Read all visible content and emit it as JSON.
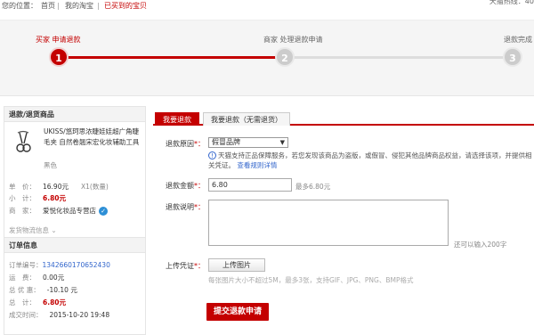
{
  "breadcrumb": {
    "label": "您的位置：",
    "items": [
      "首页",
      "我的淘宝",
      "已买到的宝贝"
    ],
    "sep": "|",
    "hotline": "天猫热线：40"
  },
  "steps": [
    {
      "num": "1",
      "label": "买家 申请退款",
      "active": true
    },
    {
      "num": "2",
      "label": "商家 处理退款申请",
      "active": false
    },
    {
      "num": "3",
      "label": "退款完成",
      "active": false
    }
  ],
  "product": {
    "section_title": "退款/退货商品",
    "name": "UKISS/悠珂思浓睫娃娃超广角睫毛夹 自然卷翘宋宏化妆辅助工具",
    "attr": "黑色",
    "unit_label": "单　价：",
    "unit_price": "16.90元",
    "quantity": "X1(数量)",
    "subtotal_label": "小　计：",
    "subtotal": "6.80元",
    "shop_label": "商　家：",
    "shop": "爱悦化妆品专营店",
    "logistics": "发货物流信息 ⌄"
  },
  "order": {
    "section_title": "订单信息",
    "number_label": "订单编号：",
    "number": "1342660170652430",
    "shipping_label": "运　费：",
    "shipping": "0.00元",
    "discount_label": "总 优 惠：",
    "discount": "-10.10 元",
    "total_label": "总　计：",
    "total": "6.80元",
    "time_label": "成交时间：",
    "time": "2015-10-20 19:48"
  },
  "tabs": [
    "我要退款",
    "我要退款（无需退货）"
  ],
  "form": {
    "reason_label": "退款原因",
    "reason_value": "假冒品牌",
    "reason_note": "天猫支持正品保障服务，若您发现该商品为盗版，或假冒、侵犯其他品牌商品权益，请选择该项，并提供相关凭证。",
    "reason_link": "查看规则详情",
    "amount_label": "退款金额",
    "amount_value": "6.80",
    "amount_max": "最多6.80元",
    "desc_label": "退款说明",
    "desc_hint": "还可以输入200字",
    "voucher_label": "上传凭证",
    "upload_btn": "上传图片",
    "upload_hint": "每张图片大小不超过5M，最多3张，支持GIF、JPG、PNG、BMP格式",
    "submit": "提交退款申请"
  },
  "colors": {
    "accent": "#c40000",
    "link": "#3366cc"
  }
}
